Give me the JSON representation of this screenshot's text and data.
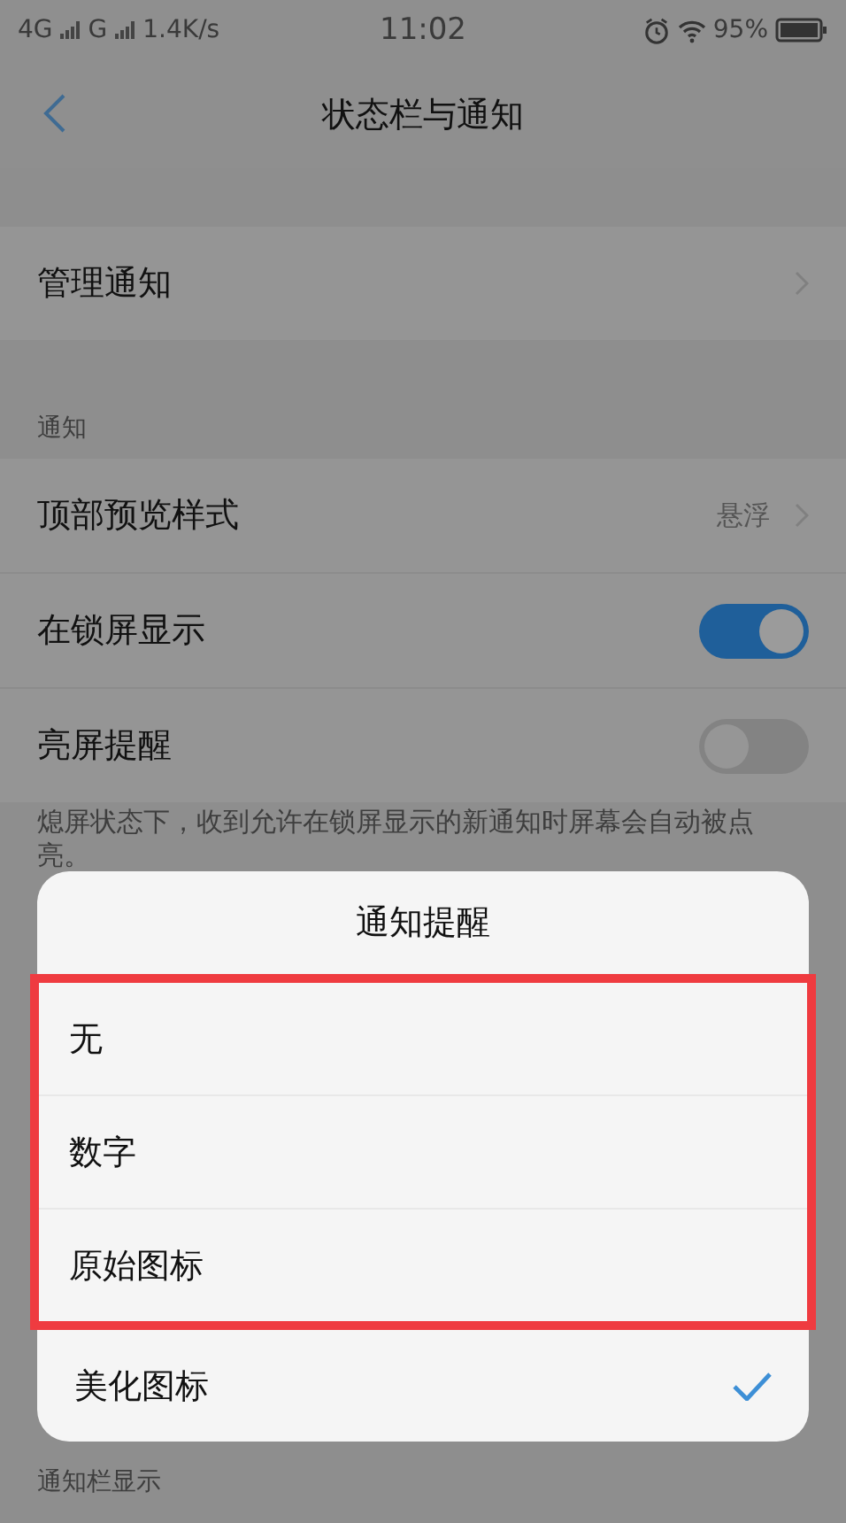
{
  "status_bar": {
    "network_1": "4G",
    "network_2": "G",
    "speed": "1.4K/s",
    "time": "11:02",
    "battery": "95%"
  },
  "header": {
    "title": "状态栏与通知"
  },
  "sections": [
    {
      "rows": [
        {
          "kind": "link",
          "label": "管理通知"
        }
      ]
    },
    {
      "title": "通知",
      "rows": [
        {
          "kind": "link",
          "label": "顶部预览样式",
          "value": "悬浮"
        },
        {
          "kind": "toggle",
          "label": "在锁屏显示",
          "on": true
        },
        {
          "kind": "toggle",
          "label": "亮屏提醒",
          "on": false
        }
      ],
      "footnote": "熄屏状态下，收到允许在锁屏显示的新通知时屏幕会自动被点亮。"
    },
    {
      "title": "通知栏显示"
    }
  ],
  "dialog": {
    "title": "通知提醒",
    "options": [
      {
        "label": "无",
        "selected": false,
        "highlighted": true
      },
      {
        "label": "数字",
        "selected": false,
        "highlighted": true
      },
      {
        "label": "原始图标",
        "selected": false,
        "highlighted": true
      },
      {
        "label": "美化图标",
        "selected": true,
        "highlighted": false
      }
    ]
  }
}
